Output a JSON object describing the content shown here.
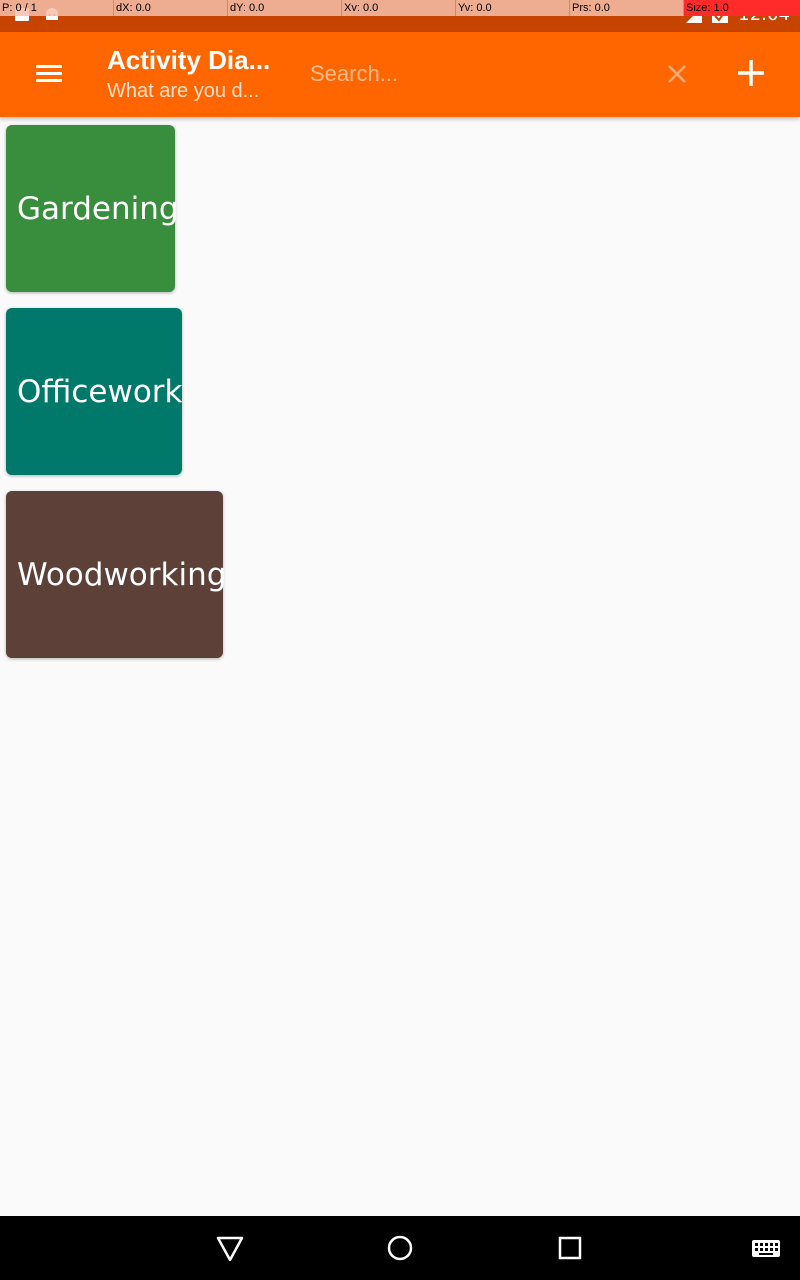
{
  "status_bar": {
    "time": "12:04",
    "icons": [
      "notification-icon",
      "android-icon",
      "signal-icon",
      "battery-icon"
    ]
  },
  "pointer_location": {
    "cells": [
      "P: 0 / 1",
      "dX: 0.0",
      "dY: 0.0",
      "Xv: 0.0",
      "Yv: 0.0",
      "Prs: 0.0",
      "Size: 1.0"
    ]
  },
  "toolbar": {
    "title": "Activity Dia...",
    "subtitle": "What are you d...",
    "search_placeholder": "Search...",
    "background_color": "#ff6600",
    "icons": [
      "menu-icon",
      "clear-icon",
      "add-icon"
    ]
  },
  "activities": [
    {
      "label": "Gardening",
      "color": "#388e3c"
    },
    {
      "label": "Officework",
      "color": "#00796b"
    },
    {
      "label": "Woodworking",
      "color": "#5d4037"
    }
  ],
  "nav_bar": {
    "icons": [
      "back-icon",
      "home-icon",
      "recents-icon",
      "keyboard-icon"
    ]
  }
}
